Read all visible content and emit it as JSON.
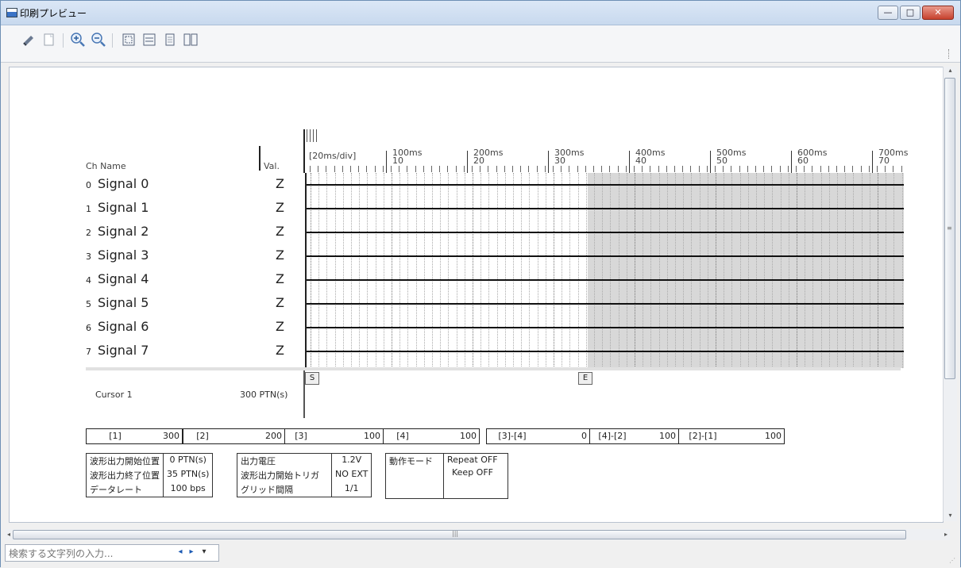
{
  "window": {
    "title": "印刷プレビュー",
    "minimize": "—",
    "maximize": "□",
    "close": "✕"
  },
  "toolbar": {
    "icons": [
      "print-icon",
      "page-icon",
      "zoom-in-icon",
      "zoom-out-icon",
      "fit-icon",
      "fit-width-icon",
      "one-page-icon",
      "two-page-icon"
    ]
  },
  "report": {
    "ch_name_header": "Ch Name",
    "val_header": "Val.",
    "time_div": "[20ms/div]",
    "time_labels": [
      {
        "ms": "100ms",
        "n": "10"
      },
      {
        "ms": "200ms",
        "n": "20"
      },
      {
        "ms": "300ms",
        "n": "30"
      },
      {
        "ms": "400ms",
        "n": "40"
      },
      {
        "ms": "500ms",
        "n": "50"
      },
      {
        "ms": "600ms",
        "n": "60"
      },
      {
        "ms": "700ms",
        "n": "70"
      }
    ],
    "signals": [
      {
        "idx": "0",
        "name": "Signal 0",
        "val": "Z"
      },
      {
        "idx": "1",
        "name": "Signal 1",
        "val": "Z"
      },
      {
        "idx": "2",
        "name": "Signal 2",
        "val": "Z"
      },
      {
        "idx": "3",
        "name": "Signal 3",
        "val": "Z"
      },
      {
        "idx": "4",
        "name": "Signal 4",
        "val": "Z"
      },
      {
        "idx": "5",
        "name": "Signal 5",
        "val": "Z"
      },
      {
        "idx": "6",
        "name": "Signal 6",
        "val": "Z"
      },
      {
        "idx": "7",
        "name": "Signal 7",
        "val": "Z"
      }
    ],
    "marker_start": "S",
    "marker_end": "E",
    "cursor_label": "Cursor 1",
    "cursor_value": "300  PTN(s)",
    "measurements": [
      {
        "label": "[1]",
        "value": "300"
      },
      {
        "label": "[2]",
        "value": "200"
      },
      {
        "label": "[3]",
        "value": "100"
      },
      {
        "label": "[4]",
        "value": "100"
      },
      {
        "label": "[3]-[4]",
        "value": "0"
      },
      {
        "label": "[4]-[2]",
        "value": "100"
      },
      {
        "label": "[2]-[1]",
        "value": "100"
      }
    ],
    "info": {
      "start_pos_label": "波形出力開始位置",
      "start_pos_value": "0 PTN(s)",
      "end_pos_label": "波形出力終了位置",
      "end_pos_value": "35 PTN(s)",
      "rate_label": "データレート",
      "rate_value": "100 bps",
      "voltage_label": "出力電圧",
      "voltage_value": "1.2V",
      "trigger_label": "波形出力開始トリガ",
      "trigger_value": "NO EXT",
      "grid_label": "グリッド間隔",
      "grid_value": "1/1",
      "mode_label": "動作モード",
      "repeat_value": "Repeat OFF",
      "keep_value": "Keep   OFF"
    }
  },
  "search": {
    "placeholder": "検索する文字列の入力...",
    "prev": "◂",
    "next": "▸",
    "options": "▾"
  },
  "scroll": {
    "up": "▴",
    "down": "▾",
    "left": "◂",
    "right": "▸",
    "grip": "≡",
    "hgrip": "|||"
  }
}
